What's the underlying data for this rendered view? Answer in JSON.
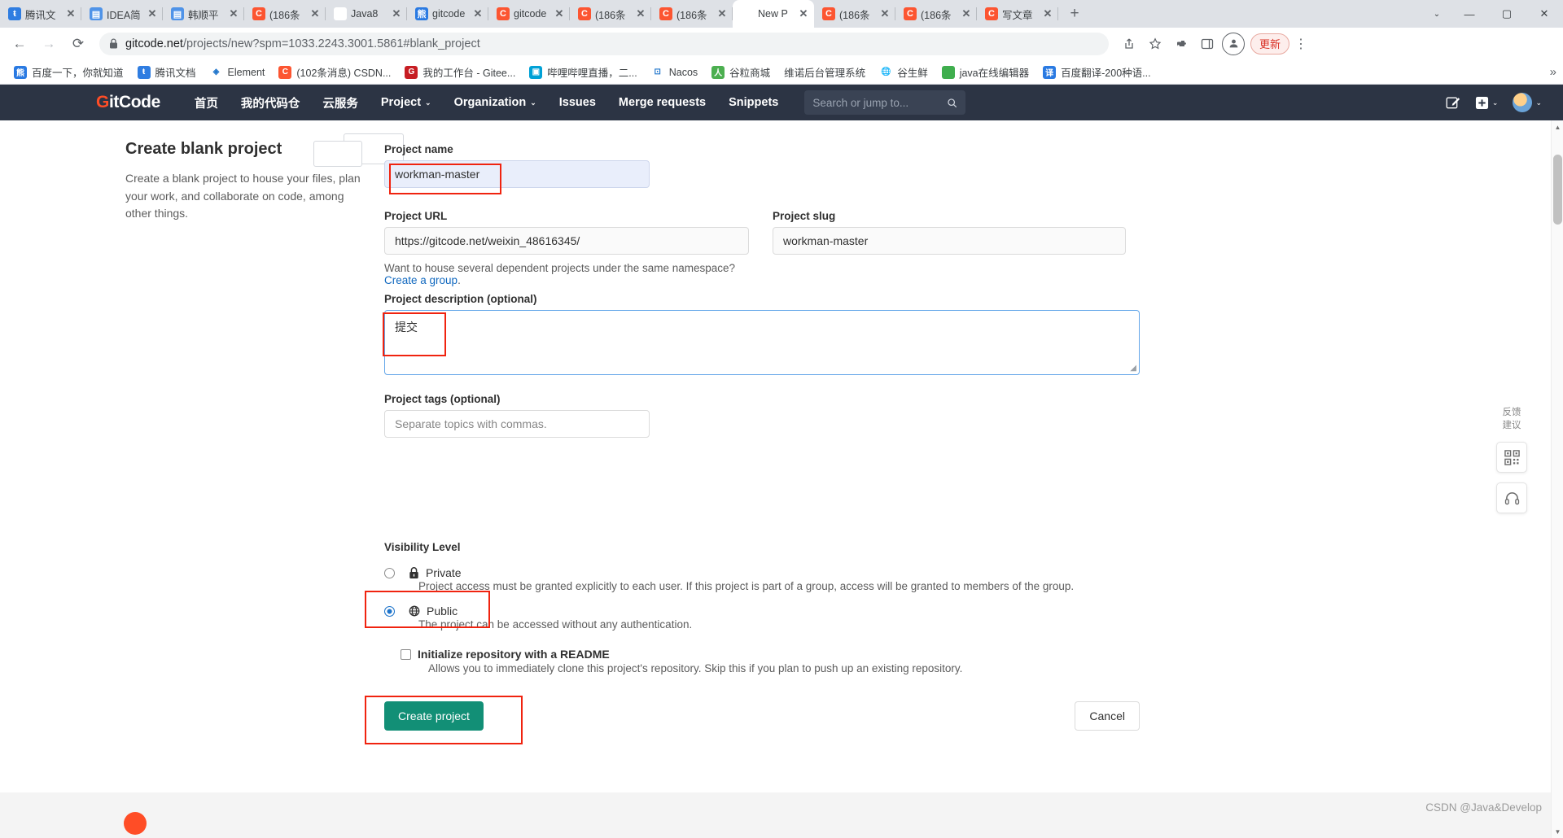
{
  "browser": {
    "tabs": [
      {
        "label": "腾讯文",
        "icon": "tencent-favicon",
        "icon_char": "ŧ",
        "fav_class": "fav-tencent",
        "active": false
      },
      {
        "label": "IDEA简",
        "icon": "doc-favicon",
        "icon_char": "▤",
        "fav_class": "fav-doc",
        "active": false
      },
      {
        "label": "韩顺平",
        "icon": "doc-favicon",
        "icon_char": "▤",
        "fav_class": "fav-doc",
        "active": false
      },
      {
        "label": "(186条",
        "icon": "csdn-favicon",
        "icon_char": "C",
        "fav_class": "fav-csdn",
        "active": false
      },
      {
        "label": "Java8",
        "icon": "google-favicon",
        "icon_char": "G",
        "fav_class": "fav-google",
        "active": false
      },
      {
        "label": "gitcode",
        "icon": "baidu-favicon",
        "icon_char": "熊",
        "fav_class": "fav-baidu",
        "active": false
      },
      {
        "label": "gitcode",
        "icon": "csdn-favicon",
        "icon_char": "C",
        "fav_class": "fav-csdn",
        "active": false
      },
      {
        "label": "(186条",
        "icon": "csdn-favicon",
        "icon_char": "C",
        "fav_class": "fav-csdn",
        "active": false
      },
      {
        "label": "(186条",
        "icon": "csdn-favicon",
        "icon_char": "C",
        "fav_class": "fav-csdn",
        "active": false
      },
      {
        "label": "New P",
        "icon": "google-favicon",
        "icon_char": "G",
        "fav_class": "fav-google",
        "active": true
      },
      {
        "label": "(186条",
        "icon": "csdn-favicon",
        "icon_char": "C",
        "fav_class": "fav-csdn",
        "active": false
      },
      {
        "label": "(186条",
        "icon": "csdn-favicon",
        "icon_char": "C",
        "fav_class": "fav-csdn",
        "active": false
      },
      {
        "label": "写文章",
        "icon": "csdn-favicon",
        "icon_char": "C",
        "fav_class": "fav-csdn",
        "active": false
      }
    ],
    "tab_close_glyph": "✕",
    "new_tab_glyph": "+",
    "window_controls": {
      "caret": "⌄",
      "minimize": "—",
      "maximize": "▢",
      "close": "✕"
    },
    "nav": {
      "back": "←",
      "forward": "→",
      "reload": "⟳"
    },
    "omnibox": {
      "lock_glyph": "🔒",
      "host": "gitcode.net",
      "path": "/projects/new?spm=1033.2243.3001.5861#blank_project",
      "full_url": "gitcode.net/projects/new?spm=1033.2243.3001.5861#blank_project"
    },
    "toolbar_icons": [
      {
        "name": "share-icon",
        "glyph": "↗"
      },
      {
        "name": "bookmark-star-icon",
        "glyph": "☆"
      },
      {
        "name": "extensions-puzzle-icon",
        "glyph": "🧩"
      },
      {
        "name": "sidepanel-icon",
        "glyph": "▯"
      },
      {
        "name": "profile-avatar-icon",
        "glyph": "👤"
      }
    ],
    "update_label": "更新",
    "menu_glyph": "⋮",
    "bookmarks": [
      {
        "label": "百度一下，你就知道",
        "icon": "baidu-icon",
        "char": "熊",
        "color": "#2a7ae2"
      },
      {
        "label": "腾讯文档",
        "icon": "tencent-docs-icon",
        "char": "ŧ",
        "color": "#2f7de1"
      },
      {
        "label": "Element",
        "icon": "element-icon",
        "char": "◈",
        "color": "#ffffff"
      },
      {
        "label": "(102条消息) CSDN...",
        "icon": "csdn-icon",
        "char": "C",
        "color": "#fc5531"
      },
      {
        "label": "我的工作台 - Gitee...",
        "icon": "gitee-icon",
        "char": "G",
        "color": "#c71d23"
      },
      {
        "label": "哔哩哔哩直播，二...",
        "icon": "bilibili-icon",
        "char": "▣",
        "color": "#00a1d6"
      },
      {
        "label": "Nacos",
        "icon": "nacos-icon",
        "char": "⊡",
        "color": "#ffffff"
      },
      {
        "label": "谷粒商城",
        "icon": "guli-mall-icon",
        "char": "人",
        "color": "#4caf50"
      },
      {
        "label": "维诺后台管理系统",
        "icon": "no-icon",
        "char": "",
        "color": "transparent"
      },
      {
        "label": "谷生鲜",
        "icon": "globe-icon",
        "char": "🌐",
        "color": "#ffffff"
      },
      {
        "label": "java在线编辑器",
        "icon": "java-editor-icon",
        "char": "</>",
        "color": "#3fae4e"
      },
      {
        "label": "百度翻译-200种语...",
        "icon": "baidu-translate-icon",
        "char": "译",
        "color": "#2a7ae2"
      }
    ],
    "bookmarks_overflow_glyph": "»"
  },
  "gitcode_nav": {
    "logo_g": "G",
    "logo_rest": "itCode",
    "links": [
      {
        "label": "首页",
        "caret": false
      },
      {
        "label": "我的代码仓",
        "caret": false
      },
      {
        "label": "云服务",
        "caret": false
      },
      {
        "label": "Project",
        "caret": true
      },
      {
        "label": "Organization",
        "caret": true
      },
      {
        "label": "Issues",
        "caret": false
      },
      {
        "label": "Merge requests",
        "caret": false
      },
      {
        "label": "Snippets",
        "caret": false
      }
    ],
    "search_placeholder": "Search or jump to...",
    "search_icon": "🔍",
    "right_icons": [
      {
        "name": "edit-icon",
        "glyph": "✎"
      },
      {
        "name": "plus-box-icon",
        "glyph": "⊞"
      },
      {
        "name": "caret-down-icon",
        "glyph": "⌄"
      }
    ],
    "avatar_caret": "⌄"
  },
  "left_panel": {
    "title": "Create blank project",
    "description": "Create a blank project to house your files, plan your work, and collaborate on code, among other things."
  },
  "form": {
    "project_name": {
      "label": "Project name",
      "value": "workman-master"
    },
    "project_url": {
      "label": "Project URL",
      "value": "https://gitcode.net/weixin_48616345/"
    },
    "project_slug": {
      "label": "Project slug",
      "value": "workman-master"
    },
    "namespace_hint": {
      "text": "Want to house several dependent projects under the same namespace? ",
      "link": "Create a group",
      "period": "."
    },
    "description": {
      "label": "Project description (optional)",
      "value": "提交"
    },
    "tags": {
      "label": "Project tags (optional)",
      "placeholder": "Separate topics with commas."
    },
    "visibility": {
      "label": "Visibility Level",
      "options": [
        {
          "title": "Private",
          "icon": "lock-icon",
          "icon_glyph": "🔒",
          "selected": false,
          "description": "Project access must be granted explicitly to each user. If this project is part of a group, access will be granted to members of the group."
        },
        {
          "title": "Public",
          "icon": "globe-icon",
          "icon_glyph": "🌐",
          "selected": true,
          "description": "The project can be accessed without any authentication."
        }
      ]
    },
    "readme": {
      "title": "Initialize repository with a README",
      "checked": false,
      "description": "Allows you to immediately clone this project's repository. Skip this if you plan to push up an existing repository."
    },
    "create_button": "Create project",
    "cancel_button": "Cancel"
  },
  "right_rail": {
    "feedback_line1": "反馈",
    "feedback_line2": "建议",
    "qr_icon": "▦",
    "support_icon": "🎧"
  },
  "watermark": "CSDN @Java&Develop",
  "colors": {
    "nav_bg": "#2c3444",
    "brand_orange": "#ff4d26",
    "primary_green": "#128f76",
    "link_blue": "#1068bf",
    "highlight_red": "#f0230f",
    "radio_blue": "#1f75cb"
  }
}
